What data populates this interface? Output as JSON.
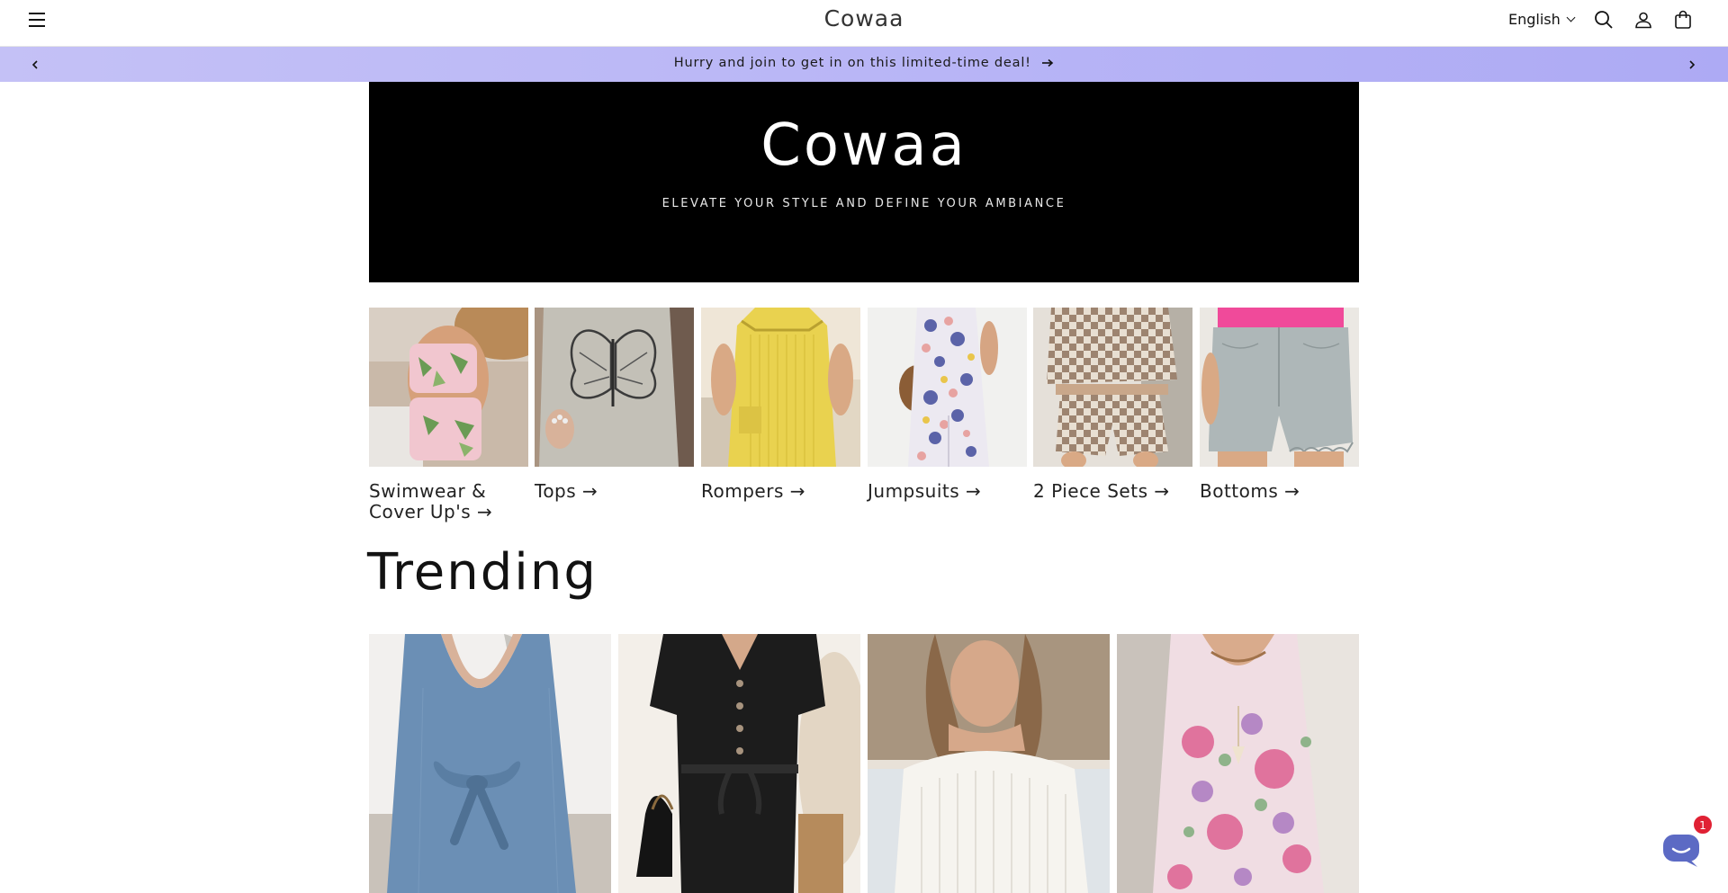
{
  "header": {
    "logo": "Cowaa",
    "language": "English"
  },
  "announcement": {
    "message": "Hurry and join to get in on this limited-time deal!"
  },
  "hero": {
    "title": "Cowaa",
    "subtitle": "ELEVATE YOUR STYLE AND DEFINE YOUR AMBIANCE"
  },
  "collections": [
    {
      "label": "Swimwear & Cover Up's →"
    },
    {
      "label": "Tops →"
    },
    {
      "label": "Rompers →"
    },
    {
      "label": "Jumpsuits →"
    },
    {
      "label": "2 Piece Sets →"
    },
    {
      "label": "Bottoms →"
    }
  ],
  "trending": {
    "title": "Trending"
  },
  "chat": {
    "badge_count": "1"
  },
  "colors": {
    "announcement_bar": "#b9b6f6",
    "hero_background": "#000000",
    "chat_button": "#5c6ac4",
    "badge": "#e02134"
  }
}
